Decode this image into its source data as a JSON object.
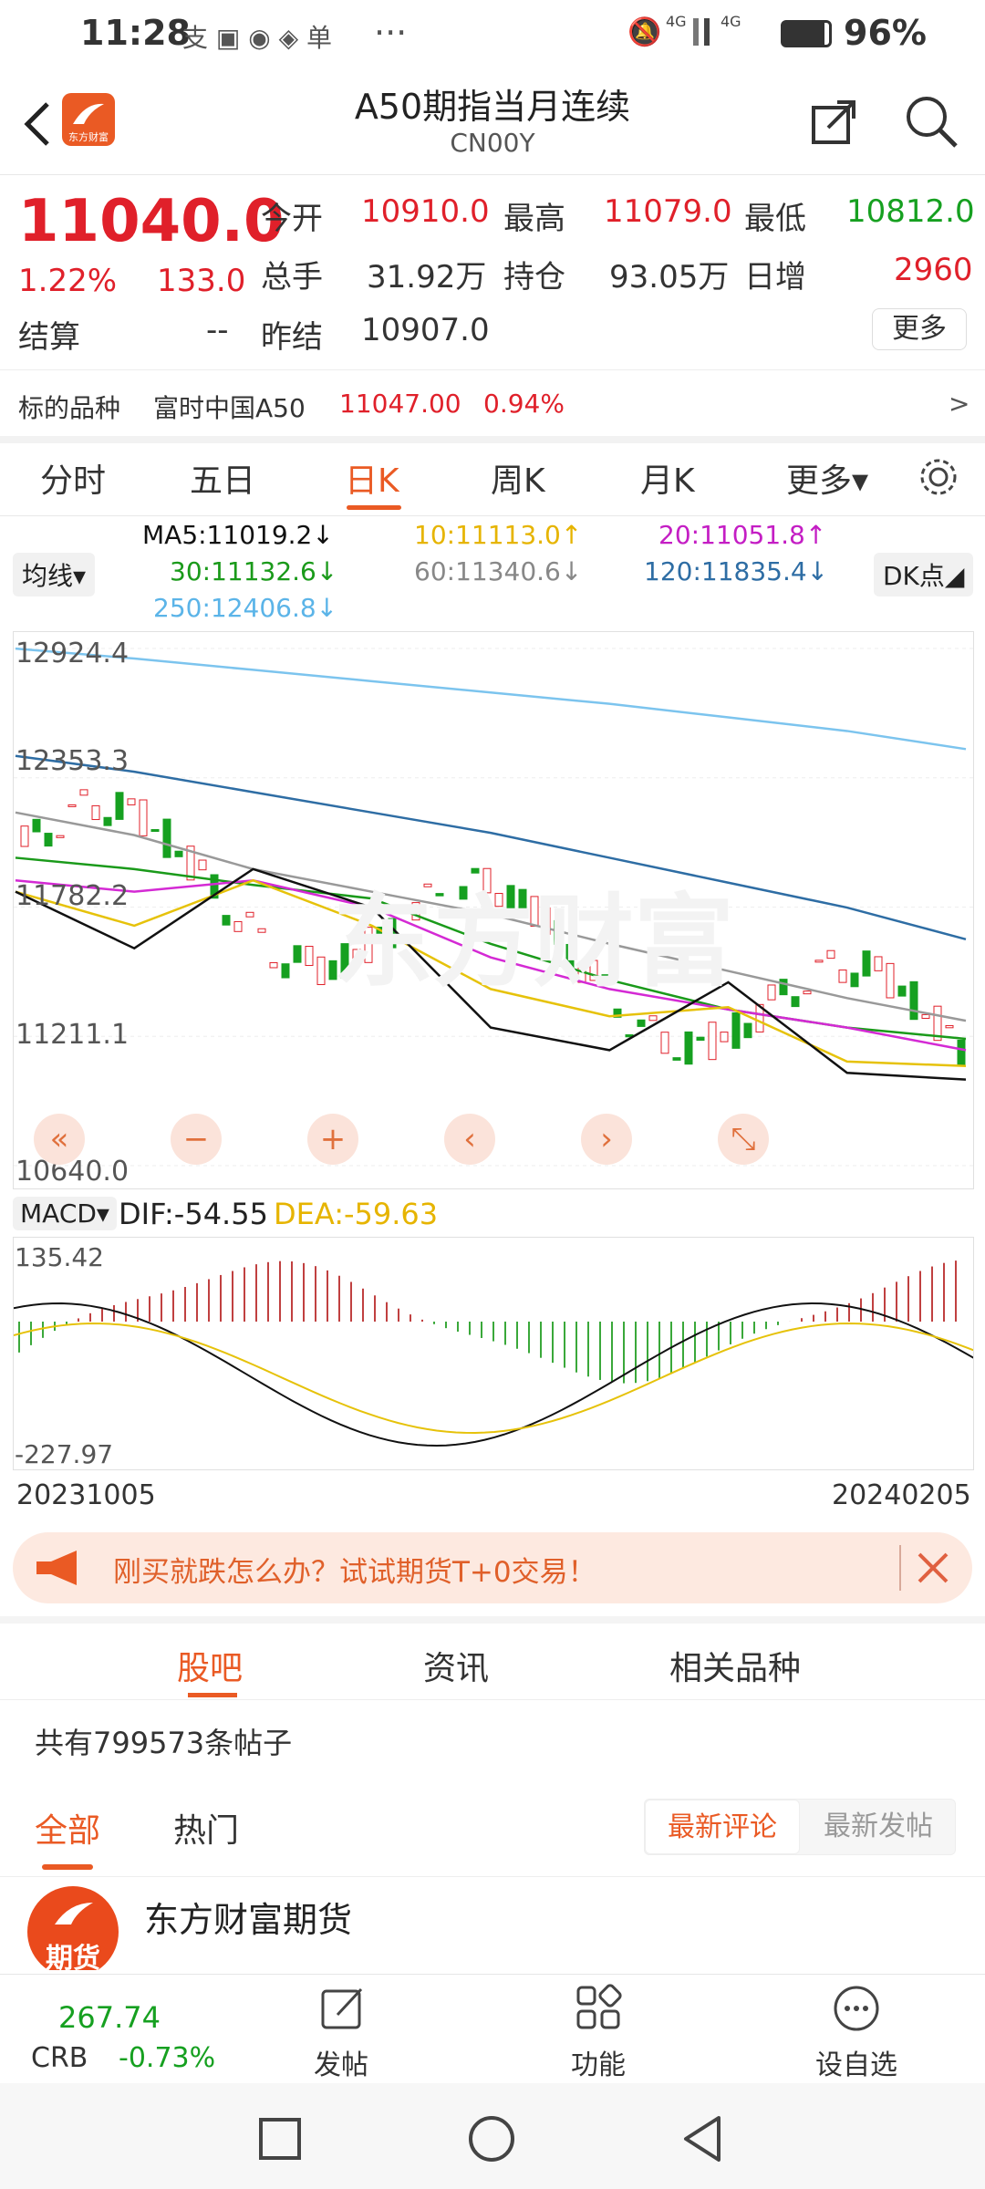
{
  "status": {
    "time": "11:28",
    "battery": "96%",
    "net1": "4G",
    "net2": "4G",
    "dots": "···"
  },
  "header": {
    "title": "A50期指当月连续",
    "code": "CN00Y",
    "brand": "东方财富"
  },
  "quote": {
    "price": "11040.0",
    "pct": "1.22%",
    "chg": "133.0",
    "labels": {
      "open": "今开",
      "high": "最高",
      "low": "最低",
      "vol": "总手",
      "oi": "持仓",
      "inc": "日增",
      "settle": "结算",
      "presettle": "昨结"
    },
    "open": "10910.0",
    "high": "11079.0",
    "low": "10812.0",
    "vol": "31.92万",
    "oi": "93.05万",
    "inc": "2960",
    "settle": "--",
    "presettle": "10907.0",
    "more": "更多"
  },
  "underlying": {
    "label": "标的品种",
    "name": "富时中国A50",
    "price": "11047.00",
    "pct": "0.94%",
    "arrow": ">"
  },
  "tabs": [
    "分时",
    "五日",
    "日K",
    "周K",
    "月K",
    "更多▾"
  ],
  "ma": {
    "selector": "均线▾",
    "ma5": "MA5:11019.2↓",
    "ma10": "10:11113.0↑",
    "ma20": "20:11051.8↑",
    "ma30": "30:11132.6↓",
    "ma60": "60:11340.6↓",
    "ma120": "120:11835.4↓",
    "ma250": "250:12406.8↓",
    "dk": "DK点◢"
  },
  "chart_data": [
    {
      "type": "line",
      "title": "日K",
      "yticks": [
        "12924.4",
        "12353.3",
        "11782.2",
        "11211.1",
        "10640.0"
      ],
      "ylim": [
        10640.0,
        12924.4
      ],
      "series": [
        {
          "name": "MA250",
          "color": "#7cc4ee",
          "values": [
            12924,
            12880,
            12830,
            12780,
            12730,
            12680,
            12620,
            12560,
            12480
          ]
        },
        {
          "name": "MA120",
          "color": "#2e6da4",
          "values": [
            12450,
            12380,
            12290,
            12200,
            12110,
            12000,
            11890,
            11780,
            11640
          ]
        },
        {
          "name": "MA60",
          "color": "#999999",
          "values": [
            12200,
            12100,
            11950,
            11850,
            11750,
            11620,
            11500,
            11380,
            11280
          ]
        },
        {
          "name": "MA30",
          "color": "#1a9a1a",
          "values": [
            12000,
            11950,
            11880,
            11820,
            11620,
            11460,
            11330,
            11250,
            11200
          ]
        },
        {
          "name": "MA20",
          "color": "#d42ad4",
          "values": [
            11900,
            11850,
            11900,
            11780,
            11560,
            11420,
            11330,
            11250,
            11150
          ]
        },
        {
          "name": "MA10",
          "color": "#e6c20a",
          "values": [
            11850,
            11700,
            11900,
            11700,
            11420,
            11300,
            11340,
            11100,
            11080
          ]
        },
        {
          "name": "MA5",
          "color": "#111111",
          "values": [
            11850,
            11600,
            11950,
            11780,
            11250,
            11150,
            11450,
            11050,
            11020
          ]
        }
      ]
    },
    {
      "type": "bar",
      "title": "MACD",
      "yticks": [
        "135.42",
        "-227.97"
      ],
      "ylim": [
        -227.97,
        135.42
      ],
      "dif": "DIF:-54.55",
      "dea": "DEA:-59.63",
      "label": "MACD▾"
    }
  ],
  "dates": {
    "start": "20231005",
    "end": "20240205"
  },
  "banner": {
    "text": "刚买就跌怎么办？试试期货T+0交易！"
  },
  "forum": {
    "tabs": [
      "股吧",
      "资讯",
      "相关品种"
    ],
    "count": "共有799573条帖子",
    "filter": [
      "全部",
      "热门"
    ],
    "sort": [
      "最新评论",
      "最新发帖"
    ],
    "poster": "东方财富期货",
    "avatar_text": "期货"
  },
  "bottom": {
    "crb_val": "267.74",
    "crb_label": "CRB",
    "crb_pct": "-0.73%",
    "post": "发帖",
    "func": "功能",
    "fav": "设自选"
  }
}
